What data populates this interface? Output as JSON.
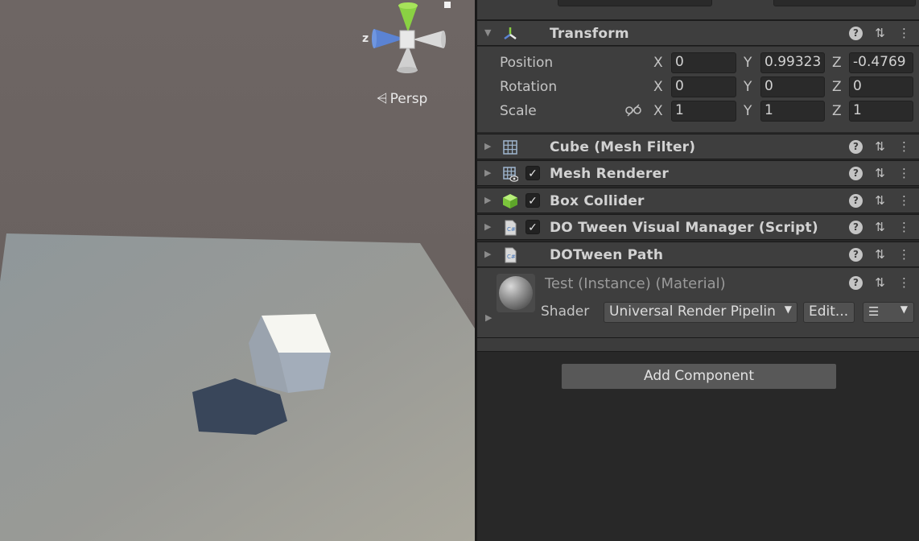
{
  "scene": {
    "view_mode_label": "Persp",
    "gizmo_axis_label": "z"
  },
  "inspector": {
    "transform": {
      "title": "Transform",
      "position": {
        "label": "Position",
        "x": "0",
        "y": "0.99323",
        "z": "-0.4769"
      },
      "rotation": {
        "label": "Rotation",
        "x": "0",
        "y": "0",
        "z": "0"
      },
      "scale": {
        "label": "Scale",
        "x": "1",
        "y": "1",
        "z": "1"
      },
      "axis_x": "X",
      "axis_y": "Y",
      "axis_z": "Z"
    },
    "components": [
      {
        "title": "Cube (Mesh Filter)",
        "has_checkbox": false,
        "icon": "mesh-filter-icon"
      },
      {
        "title": "Mesh Renderer",
        "has_checkbox": true,
        "checked": true,
        "icon": "mesh-renderer-icon"
      },
      {
        "title": "Box Collider",
        "has_checkbox": true,
        "checked": true,
        "icon": "box-collider-icon"
      },
      {
        "title": "DO Tween Visual Manager (Script)",
        "has_checkbox": true,
        "checked": true,
        "icon": "csharp-script-icon"
      },
      {
        "title": "DOTween Path",
        "has_checkbox": false,
        "icon": "csharp-script-icon"
      }
    ],
    "material": {
      "title": "Test (Instance) (Material)",
      "shader_label": "Shader",
      "shader_value": "Universal Render Pipelin",
      "edit_label": "Edit..."
    },
    "add_component_label": "Add Component",
    "checkmark": "✓",
    "colors": {
      "panel": "#282828",
      "header": "#3e3e3e",
      "field": "#2a2a2a",
      "button": "#585858"
    }
  }
}
